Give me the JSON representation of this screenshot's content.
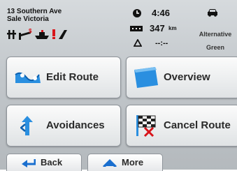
{
  "location": {
    "street": "13 Southern Ave",
    "city": "Sale Victoria"
  },
  "status": {
    "time": "4:46",
    "distance_value": "347",
    "distance_unit": "km",
    "eta": "--:--",
    "route_label_line1": "Alternative",
    "route_label_line2": "Green"
  },
  "menu": {
    "edit_route": "Edit Route",
    "overview": "Overview",
    "avoidances": "Avoidances",
    "cancel_route": "Cancel Route"
  },
  "bottom": {
    "back": "Back",
    "more": "More"
  },
  "colors": {
    "icon_blue": "#2a8fe0",
    "icon_red": "#d8141a"
  }
}
